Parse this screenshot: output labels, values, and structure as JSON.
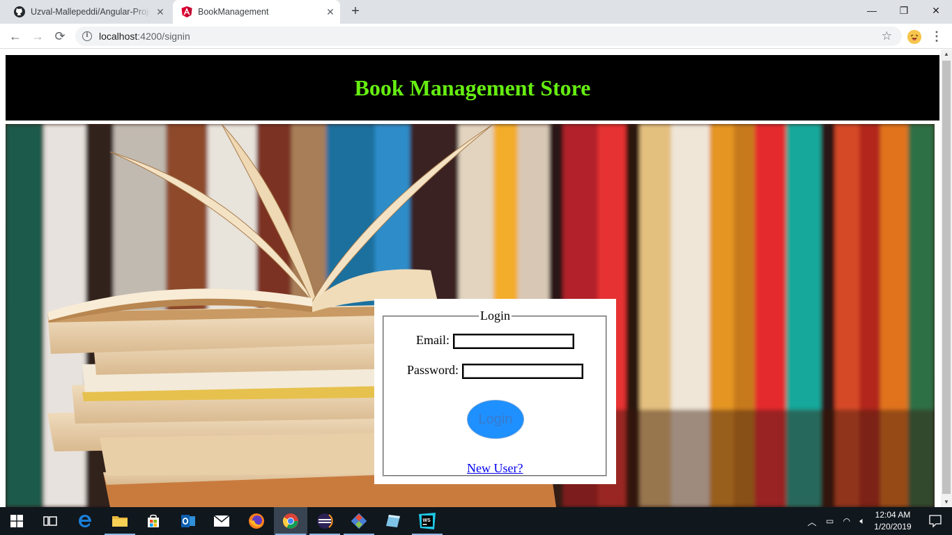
{
  "browser": {
    "tabs": [
      {
        "title": "Uzval-Mallepeddi/Angular-Project",
        "icon": "github-icon",
        "active": false
      },
      {
        "title": "BookManagement",
        "icon": "angular-icon",
        "active": true
      }
    ],
    "new_tab_symbol": "+",
    "window_controls": {
      "minimize": "—",
      "maximize": "❐",
      "close": "✕"
    },
    "nav": {
      "back": "←",
      "forward": "→",
      "reload": "⟳"
    },
    "url": {
      "host": "localhost",
      "path": ":4200/signin"
    },
    "bookmark_icon": "star-icon",
    "menu_symbol": "⋮"
  },
  "page": {
    "site_title": "Book Management Store",
    "login": {
      "legend": "Login",
      "email_label": "Email:",
      "email_value": "",
      "password_label": "Password:",
      "password_value": "",
      "submit_label": "Login",
      "new_user_link": "New User?"
    }
  },
  "taskbar": {
    "apps": [
      "start",
      "task-view",
      "edge",
      "file-explorer",
      "store",
      "outlook",
      "mail",
      "firefox",
      "chrome",
      "eclipse",
      "git",
      "notepad",
      "webstorm"
    ],
    "clock": {
      "time": "12:04 AM",
      "date": "1/20/2019"
    }
  },
  "colors": {
    "site_title": "#66ee11",
    "header_bg": "#000000",
    "login_button": "#1e90ff",
    "link": "#0000ee"
  }
}
